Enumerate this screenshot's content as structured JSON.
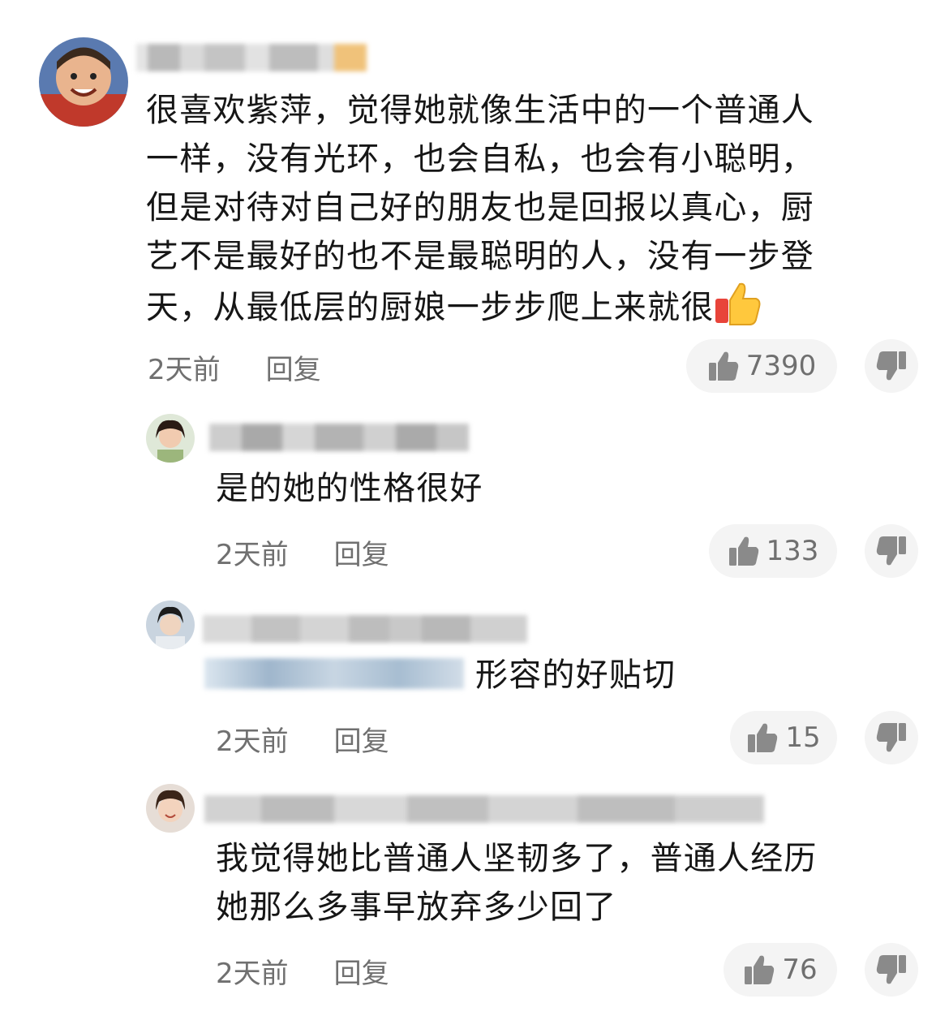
{
  "comments": [
    {
      "text_lines": [
        "很喜欢紫萍，觉得她就像生活中的一个普通人",
        "一样，没有光环，也会自私，也会有小聪明，",
        "但是对待对自己好的朋友也是回报以真心，厨",
        "艺不是最好的也不是最聪明的人，没有一步登",
        "天，从最低层的厨娘一步步爬上来就很"
      ],
      "time": "2天前",
      "reply_label": "回复",
      "likes": "7390",
      "emoji": "thumbs-up-icon"
    },
    {
      "text": "是的她的性格很好",
      "time": "2天前",
      "reply_label": "回复",
      "likes": "133"
    },
    {
      "text": "形容的好贴切",
      "time": "2天前",
      "reply_label": "回复",
      "likes": "15"
    },
    {
      "text_lines": [
        "我觉得她比普通人坚韧多了，普通人经历",
        "她那么多事早放弃多少回了"
      ],
      "time": "2天前",
      "reply_label": "回复",
      "likes": "76"
    }
  ],
  "colors": {
    "meta_text": "#707070",
    "pill_bg": "#f4f4f4",
    "icon": "#8a8a8a"
  }
}
